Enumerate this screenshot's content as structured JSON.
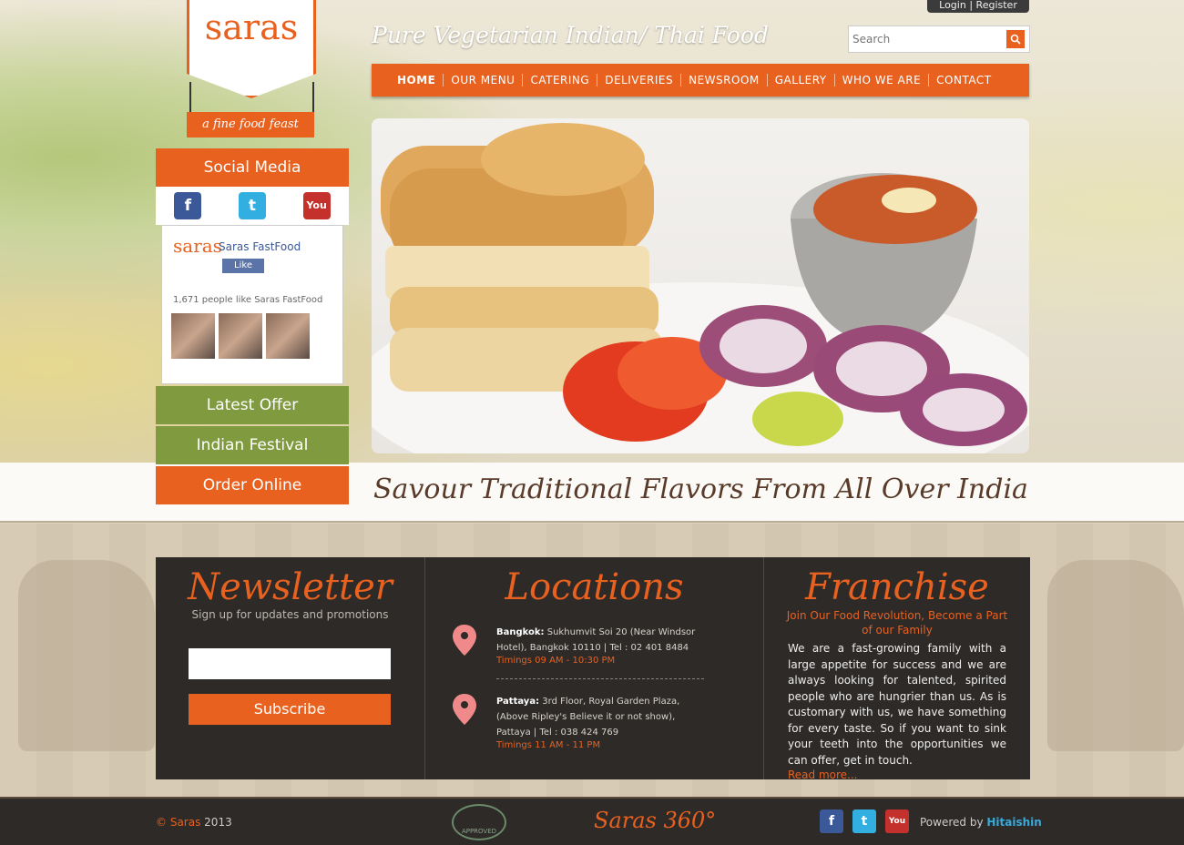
{
  "header": {
    "logo_text": "saras",
    "logo_tagline": "a fine food feast",
    "tagline": "Pure Vegetarian Indian/ Thai Food",
    "login_label": "Login",
    "register_label": "Register",
    "search_placeholder": "Search"
  },
  "nav": {
    "items": [
      {
        "label": "HOME"
      },
      {
        "label": "OUR MENU"
      },
      {
        "label": "CATERING"
      },
      {
        "label": "DELIVERIES"
      },
      {
        "label": "NEWSROOM"
      },
      {
        "label": "GALLERY"
      },
      {
        "label": "WHO WE ARE"
      },
      {
        "label": "CONTACT"
      }
    ]
  },
  "sidebar": {
    "social_title": "Social Media",
    "fb_widget": {
      "logo": "saras",
      "page_name": "Saras FastFood",
      "like_label": "Like",
      "count_text": "1,671 people like Saras FastFood"
    },
    "buttons": [
      {
        "label": "Latest Offer",
        "color": "#7f9a3f"
      },
      {
        "label": "Indian Festival",
        "color": "#7f9a3f"
      },
      {
        "label": "Order Online",
        "color": "#e8611f"
      }
    ]
  },
  "banner": {
    "savour_text": "Savour Traditional Flavors From All Over India"
  },
  "newsletter": {
    "title": "Newsletter",
    "subtitle": "Sign up for updates and promotions",
    "button_label": "Subscribe"
  },
  "locations": {
    "title": "Locations",
    "items": [
      {
        "name": "Bangkok:",
        "address": "Sukhumvit Soi 20 (Near Windsor Hotel), Bangkok 10110 | Tel : 02 401 8484",
        "timings": "Timings 09 AM - 10:30 PM"
      },
      {
        "name": "Pattaya:",
        "address": "3rd Floor, Royal Garden Plaza, (Above Ripley's Believe it or not show), Pattaya | Tel : 038 424 769",
        "timings": "Timings 11 AM - 11 PM"
      }
    ]
  },
  "franchise": {
    "title": "Franchise",
    "subtitle": "Join Our Food Revolution, Become a Part of our Family",
    "text": "We are a fast-growing family with a large appetite for success and we are always looking for talented, spirited people who are hungrier than us. As is customary with us, we have something for every taste. So if you want to sink your teeth into the opportunities we can offer, get in touch.",
    "read_more": "Read more..."
  },
  "footer": {
    "copyright_symbol": "©",
    "brand": "Saras",
    "year": "2013",
    "badge_text": "APPROVED",
    "saras360": "Saras 360°",
    "powered_prefix": "Powered by",
    "powered_by": "Hitaishin"
  },
  "colors": {
    "accent": "#e8611f",
    "green": "#7f9a3f",
    "dark_panel": "#2d2a28"
  },
  "icons": [
    "facebook-icon",
    "twitter-icon",
    "youtube-icon",
    "search-icon",
    "location-pin-icon"
  ]
}
